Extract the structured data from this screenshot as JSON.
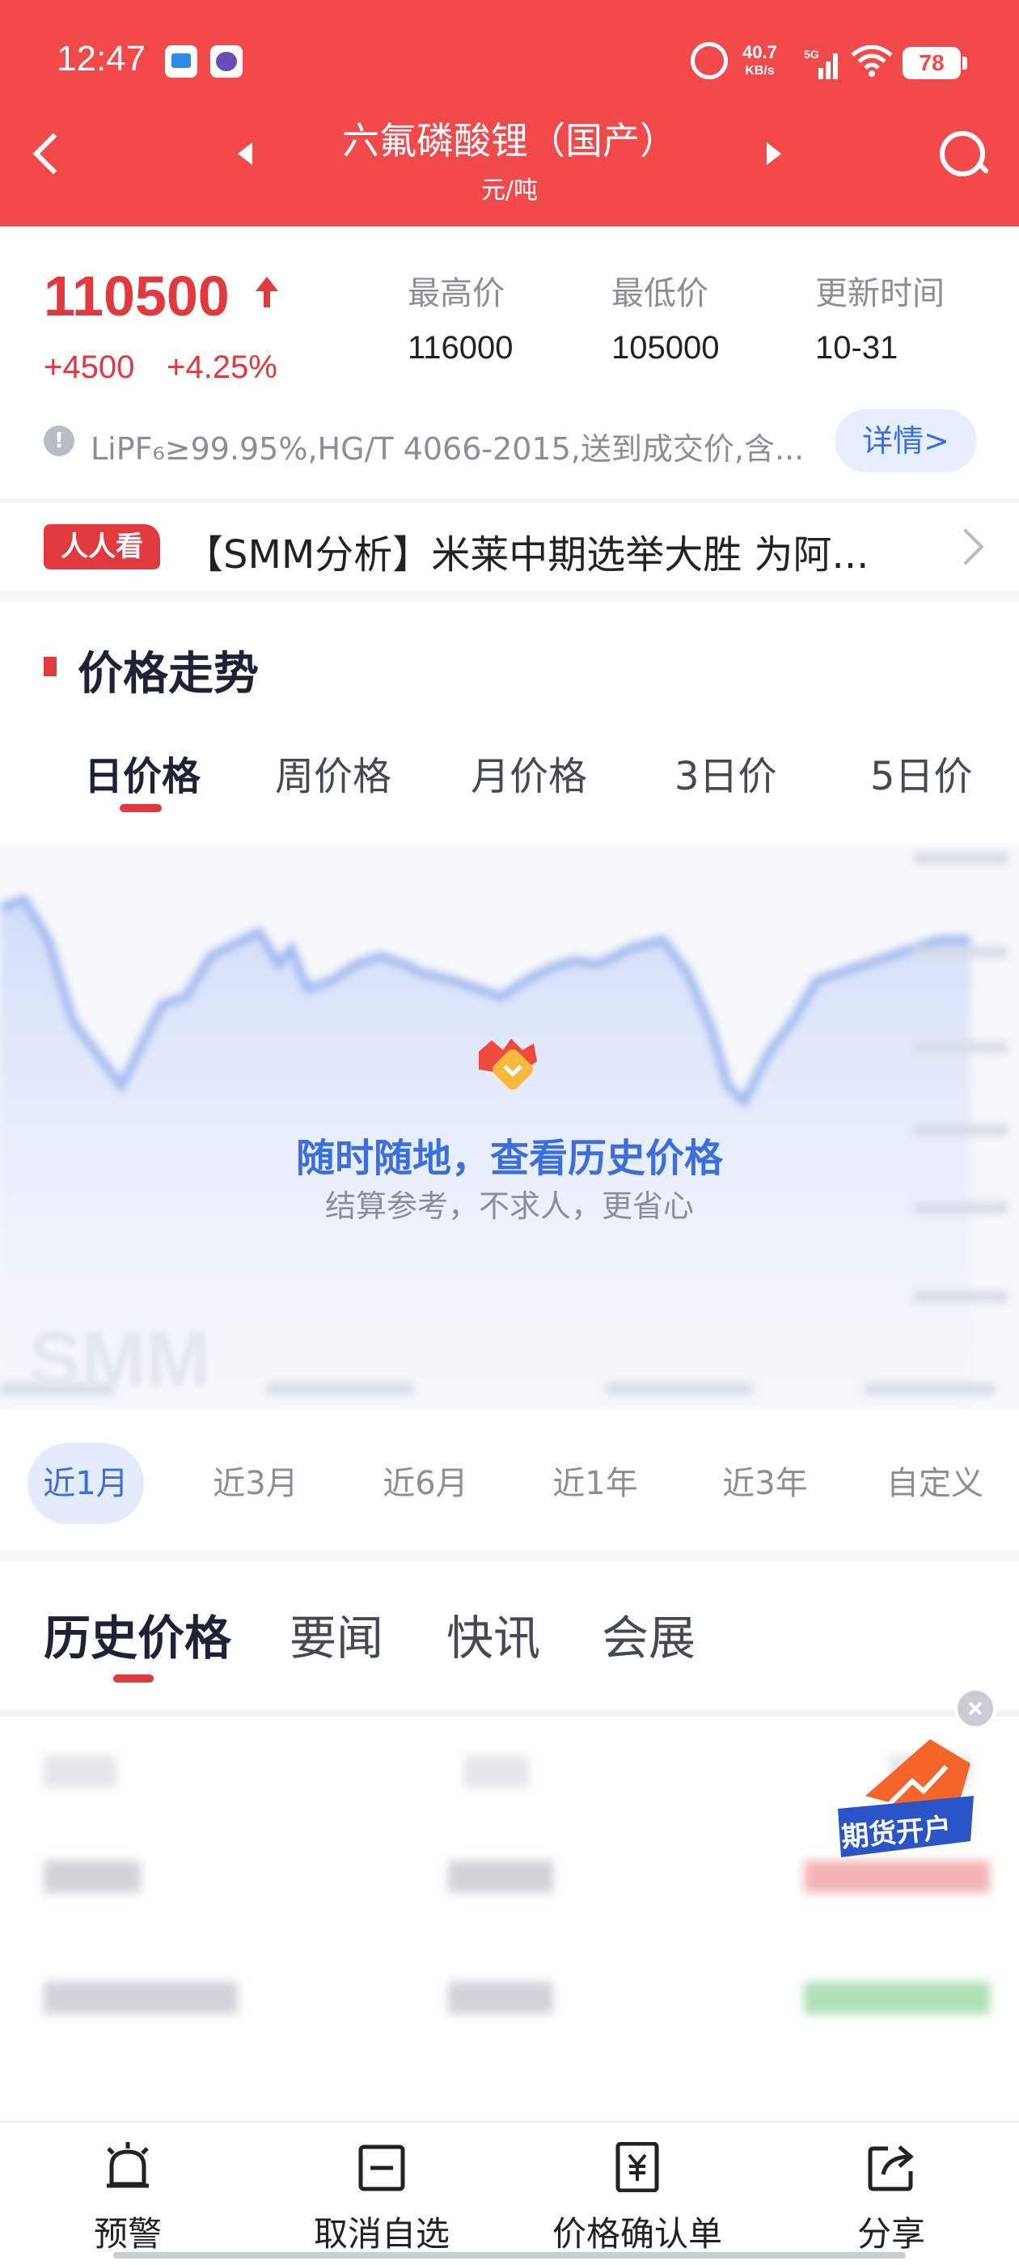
{
  "status_bar": {
    "time": "12:47",
    "net_speed": "40.7",
    "net_unit": "KB/s",
    "network": "5G",
    "battery": "78"
  },
  "header": {
    "title": "六氟磷酸锂（国产）",
    "unit": "元/吨"
  },
  "summary": {
    "price": "110500",
    "change": "+4500",
    "change_pct": "+4.25%",
    "high_label": "最高价",
    "high_value": "116000",
    "low_label": "最低价",
    "low_value": "105000",
    "update_label": "更新时间",
    "update_value": "10-31",
    "note": "LiPF₆≥99.95%,HG/T 4066-2015,送到成交价,含...",
    "detail_button": "详情>"
  },
  "ticker": {
    "tag": "人人看",
    "headline": "【SMM分析】米莱中期选举大胜 为阿..."
  },
  "trend": {
    "title": "价格走势",
    "period_tabs": [
      "日价格",
      "周价格",
      "月价格",
      "3日价",
      "5日价"
    ],
    "active_period": "日价格",
    "unlock_title": "随时随地，查看历史价格",
    "unlock_subtitle": "结算参考，不求人，更省心",
    "watermark": "SMM",
    "range_tabs": [
      "近1月",
      "近3月",
      "近6月",
      "近1年",
      "近3年",
      "自定义"
    ],
    "active_range": "近1月"
  },
  "history": {
    "tabs": [
      "历史价格",
      "要闻",
      "快讯",
      "会展"
    ],
    "active_tab": "历史价格"
  },
  "promo": {
    "label": "期货开户"
  },
  "bottom_bar": {
    "items": [
      {
        "label": "预警",
        "icon": "alarm-icon"
      },
      {
        "label": "取消自选",
        "icon": "minus-box-icon"
      },
      {
        "label": "价格确认单",
        "icon": "yuan-doc-icon"
      },
      {
        "label": "分享",
        "icon": "share-icon"
      }
    ]
  },
  "colors": {
    "brand_red": "#f24a4b",
    "up_red": "#e0393e",
    "accent_blue": "#3b6fe0"
  }
}
